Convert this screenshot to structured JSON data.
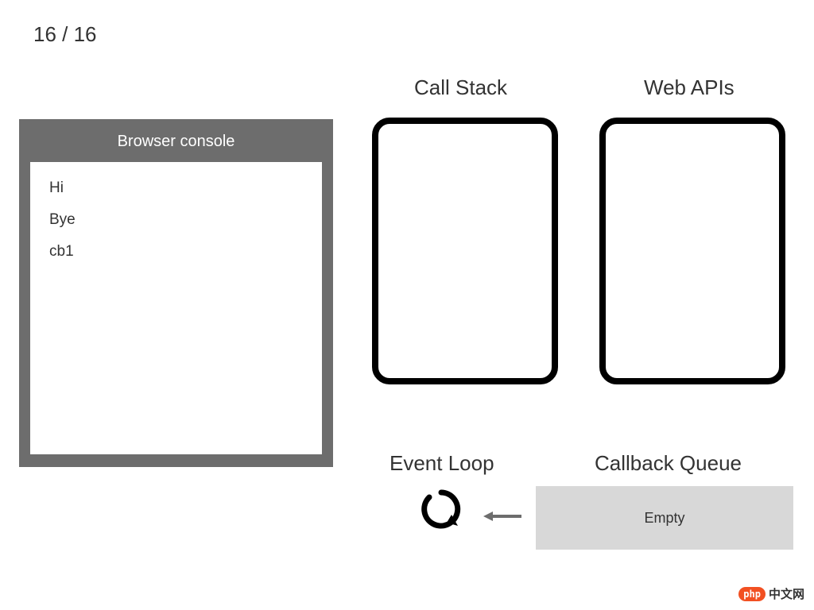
{
  "step": {
    "current": 16,
    "total": 16,
    "display": "16 / 16"
  },
  "console": {
    "title": "Browser console",
    "lines": [
      "Hi",
      "Bye",
      "cb1"
    ]
  },
  "titles": {
    "call_stack": "Call Stack",
    "web_apis": "Web APIs",
    "event_loop": "Event Loop",
    "callback_queue": "Callback Queue"
  },
  "callback_queue": {
    "content": "Empty"
  },
  "watermark": {
    "badge": "php",
    "text": "中文网"
  }
}
